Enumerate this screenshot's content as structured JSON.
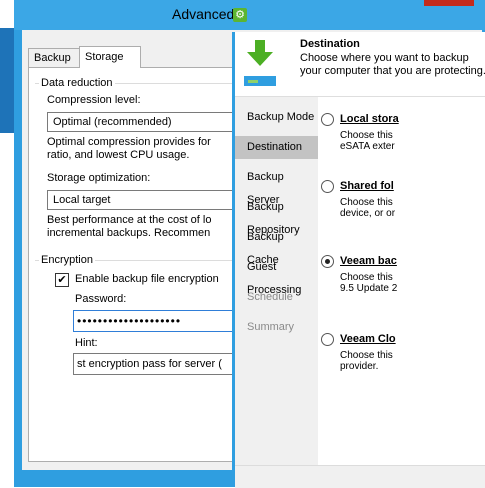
{
  "advanced_window": {
    "title": "Advanced",
    "tabs": [
      "Backup",
      "Storage"
    ],
    "data_reduction": {
      "group_label": "Data reduction",
      "compression_label": "Compression level:",
      "compression_value": "Optimal (recommended)",
      "compression_desc_line1": "Optimal compression provides for",
      "compression_desc_line2": "ratio, and lowest CPU usage.",
      "storage_label": "Storage optimization:",
      "storage_value": "Local target",
      "storage_desc_line1": "Best performance at the cost of lo",
      "storage_desc_line2": "incremental backups. Recommen"
    },
    "encryption": {
      "group_label": "Encryption",
      "enable_label": "Enable backup file encryption",
      "enable_checked": true,
      "checkmark": "✔",
      "password_label": "Password:",
      "password_value": "••••••••••••••••••••",
      "hint_label": "Hint:",
      "hint_value": "st encryption pass for server ("
    }
  },
  "wizard": {
    "title": "Destination",
    "subtitle": "Choose where you want to backup your computer that you are protecting.",
    "steps": [
      {
        "label": "Backup Mode",
        "state": "normal"
      },
      {
        "label": "Destination",
        "state": "active"
      },
      {
        "label": "Backup Server",
        "state": "normal"
      },
      {
        "label": "Backup Repository",
        "state": "normal"
      },
      {
        "label": "Backup Cache",
        "state": "normal"
      },
      {
        "label": "Guest Processing",
        "state": "normal"
      },
      {
        "label": "Schedule",
        "state": "disabled"
      },
      {
        "label": "Summary",
        "state": "disabled"
      }
    ],
    "options": [
      {
        "title": "Local stora",
        "desc1": "Choose this",
        "desc2": "eSATA exter",
        "selected": false
      },
      {
        "title": "Shared fol",
        "desc1": "Choose this",
        "desc2": "device, or or",
        "selected": false
      },
      {
        "title": "Veeam bac",
        "desc1": "Choose this",
        "desc2": "9.5 Update 2",
        "selected": true
      },
      {
        "title": "Veeam Clo",
        "desc1": "Choose this",
        "desc2": "provider.",
        "selected": false
      }
    ]
  },
  "colors": {
    "accent_blue": "#2f9ee0",
    "gear_green": "#5cb531",
    "arrow_green": "#4caf24"
  }
}
